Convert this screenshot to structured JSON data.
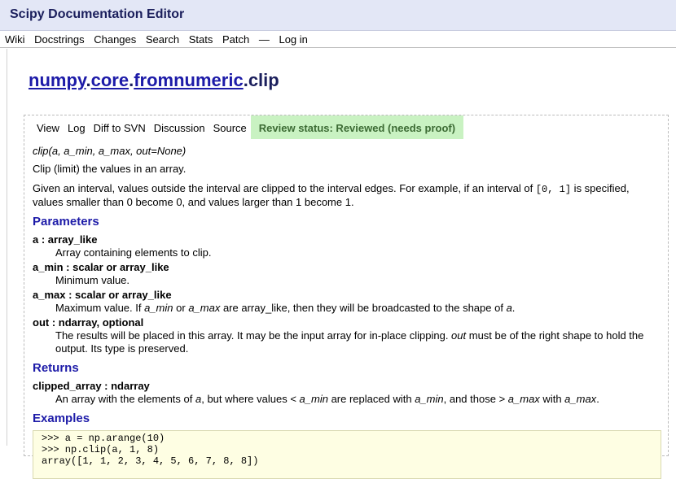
{
  "site": {
    "title": "Scipy Documentation Editor"
  },
  "nav": [
    "Wiki",
    "Docstrings",
    "Changes",
    "Search",
    "Stats",
    "Patch",
    "—",
    "Log in"
  ],
  "page_title": {
    "part1": "numpy",
    "dot1": ".",
    "part2": "core",
    "dot2": ".",
    "part3": "fromnumeric",
    "tail": ".clip"
  },
  "tabs": [
    "View",
    "Log",
    "Diff to SVN",
    "Discussion",
    "Source"
  ],
  "review_status": "Review status: Reviewed (needs proof)",
  "doc": {
    "signature": "clip(a, a_min, a_max, out=None)",
    "summary": "Clip (limit) the values in an array.",
    "intro_before": "Given an interval, values outside the interval are clipped to the interval edges. For example, if an interval of ",
    "intro_code": "[0, 1]",
    "intro_after": " is specified, values smaller than 0 become 0, and values larger than 1 become 1.",
    "parameters_heading": "Parameters",
    "param_a_name": "a : array_like",
    "param_a_desc": "Array containing elements to clip.",
    "param_amin_name": "a_min : scalar or array_like",
    "param_amin_desc": "Minimum value.",
    "param_amax_name": "a_max : scalar or array_like",
    "param_amax_desc_1": "Maximum value. If ",
    "param_amax_desc_2": "a_min",
    "param_amax_desc_3": " or ",
    "param_amax_desc_4": "a_max",
    "param_amax_desc_5": " are array_like, then they will be broadcasted to the shape of ",
    "param_amax_desc_6": "a",
    "param_amax_desc_7": ".",
    "param_out_name": "out : ndarray, optional",
    "param_out_desc_1": "The results will be placed in this array. It may be the input array for in-place clipping. ",
    "param_out_desc_2": "out",
    "param_out_desc_3": " must be of the right shape to hold the output. Its type is preserved.",
    "returns_heading": "Returns",
    "ret_name": "clipped_array : ndarray",
    "ret_desc_1": "An array with the elements of ",
    "ret_desc_2": "a",
    "ret_desc_3": ", but where values < ",
    "ret_desc_4": "a_min",
    "ret_desc_5": " are replaced with ",
    "ret_desc_6": "a_min",
    "ret_desc_7": ", and those > ",
    "ret_desc_8": "a_max",
    "ret_desc_9": " with ",
    "ret_desc_10": "a_max",
    "ret_desc_11": ".",
    "examples_heading": "Examples",
    "code_lines": [
      ">>> a = np.arange(10)",
      ">>> np.clip(a, 1, 8)",
      "array([1, 1, 2, 3, 4, 5, 6, 7, 8, 8])"
    ]
  }
}
